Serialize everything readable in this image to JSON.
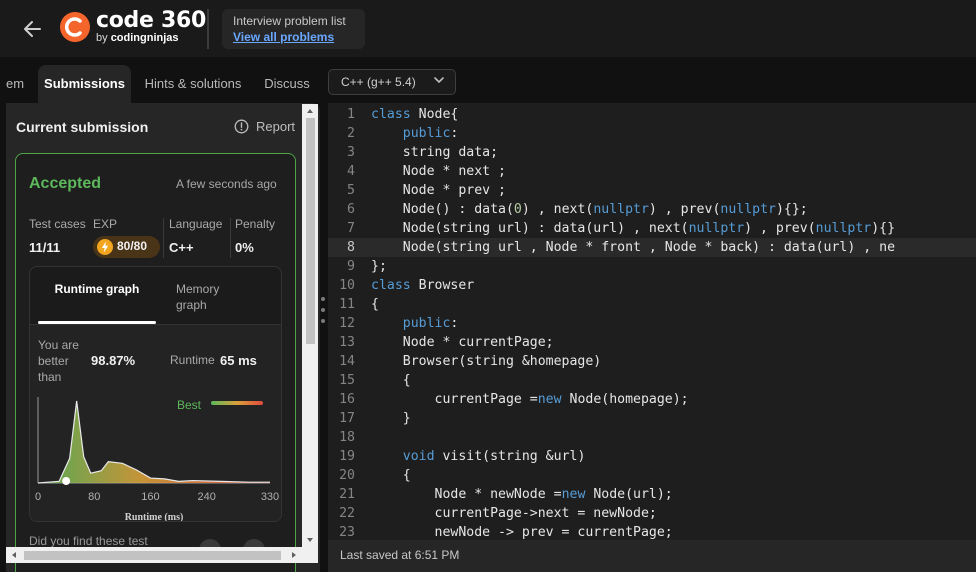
{
  "header": {
    "logo_word": "code",
    "logo_number": "360",
    "logo_by": "by",
    "logo_brand": "codingninjas",
    "problem_list_label": "Interview problem list",
    "view_all_link": "View all problems"
  },
  "tabs": [
    {
      "label": "em"
    },
    {
      "label": "Submissions"
    },
    {
      "label": "Hints & solutions"
    },
    {
      "label": "Discuss"
    }
  ],
  "language_selector": {
    "value": "C++ (g++ 5.4)"
  },
  "left_panel": {
    "title": "Current submission",
    "report_label": "Report",
    "status": "Accepted",
    "status_color": "#5db85b",
    "time": "A few seconds ago",
    "stats": {
      "test_cases_label": "Test cases",
      "test_cases_value": "11/11",
      "exp_label": "EXP",
      "exp_value": "80/80",
      "language_label": "Language",
      "language_value": "C++",
      "penalty_label": "Penalty",
      "penalty_value": "0%"
    },
    "graph_tabs": [
      "Runtime graph",
      "Memory graph"
    ],
    "better_than_label": "You are better than",
    "better_than_value": "98.87%",
    "runtime_label": "Runtime",
    "runtime_value": "65 ms",
    "feedback_text": "Did you find these test"
  },
  "chart_data": {
    "type": "area",
    "xlabel": "Runtime (ms)",
    "ylabel": "",
    "legend": "Best",
    "x_ticks": [
      0,
      80,
      160,
      240,
      330
    ],
    "xlim": [
      0,
      330
    ],
    "ylim": [
      0,
      1
    ],
    "x": [
      0,
      30,
      45,
      55,
      65,
      75,
      90,
      100,
      120,
      140,
      160,
      180,
      200,
      220,
      260,
      300,
      330
    ],
    "values": [
      0,
      0.02,
      0.3,
      1.0,
      0.32,
      0.12,
      0.15,
      0.26,
      0.24,
      0.16,
      0.06,
      0.05,
      0.02,
      0.03,
      0.02,
      0.01,
      0.01
    ],
    "marker_x": 40,
    "colors": {
      "best": "#5db85b",
      "worst": "#e04a3c",
      "mid": "#d9a03a"
    }
  },
  "editor": {
    "lines": [
      "class Node{",
      "    public:",
      "    string data;",
      "    Node * next ;",
      "    Node * prev ;",
      "    Node() : data(0) , next(nullptr) , prev(nullptr){};",
      "    Node(string url) : data(url) , next(nullptr) , prev(nullptr){}",
      "    Node(string url , Node * front , Node * back) : data(url) , ne",
      "};",
      "class Browser",
      "{",
      "    public:",
      "    Node * currentPage;",
      "    Browser(string &homepage)",
      "    {",
      "        currentPage =new Node(homepage);",
      "    }",
      "",
      "    void visit(string &url)",
      "    {",
      "        Node * newNode =new Node(url);",
      "        currentPage->next = newNode;",
      "        newNode -> prev = currentPage;"
    ],
    "active_line": 8
  },
  "status_bar": {
    "last_saved": "Last saved at 6:51 PM"
  }
}
